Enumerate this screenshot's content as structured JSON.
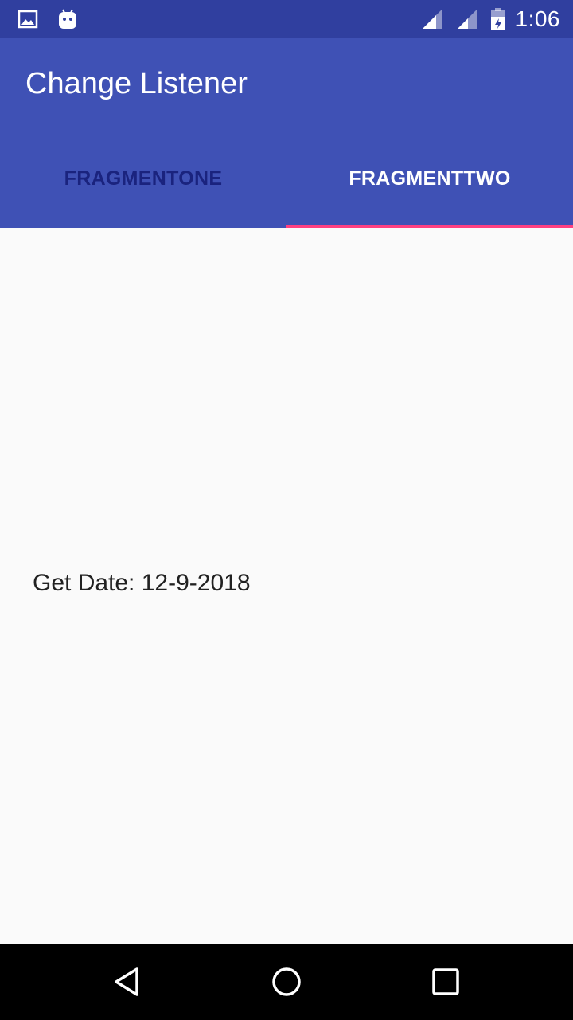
{
  "status_bar": {
    "left_icons": [
      "image-icon",
      "android-icon"
    ],
    "right_icons": [
      "signal-icon",
      "signal-icon",
      "battery-icon"
    ],
    "time": "1:06"
  },
  "app_bar": {
    "title": "Change Listener",
    "color": "#3f51b5",
    "status_color": "#303f9f"
  },
  "tabs": [
    {
      "label": "FRAGMENTONE",
      "selected": false
    },
    {
      "label": "FRAGMENTTWO",
      "selected": true
    }
  ],
  "accent_color": "#ff4081",
  "content": {
    "date_text": "Get Date: 12-9-2018"
  },
  "nav_bar": {
    "buttons": [
      "back-icon",
      "home-icon",
      "recents-icon"
    ]
  }
}
